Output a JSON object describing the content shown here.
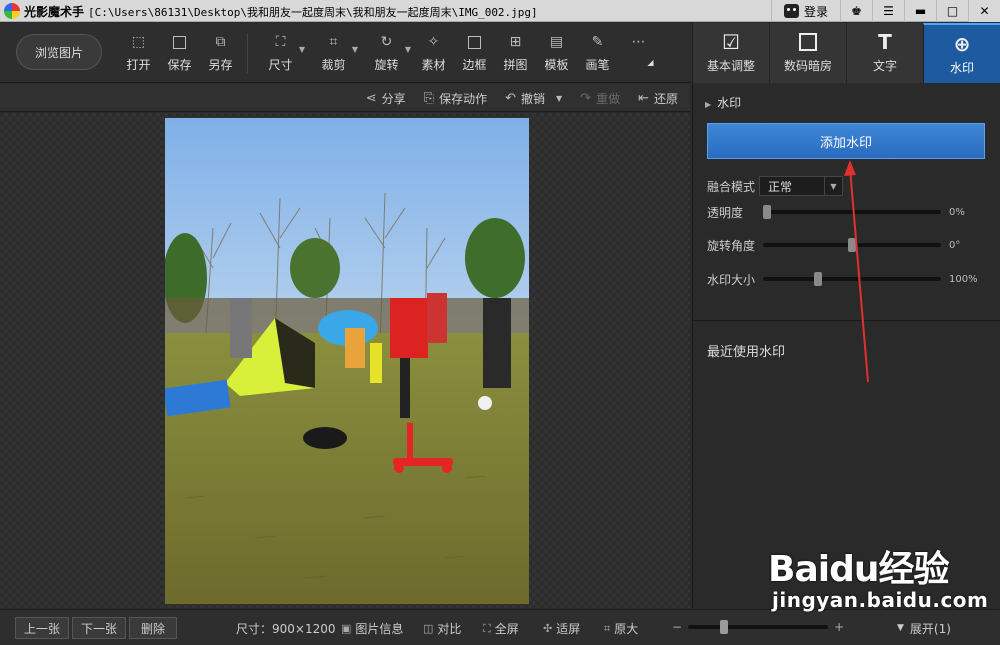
{
  "titlebar": {
    "app_name": "光影魔术手",
    "path": "[C:\\Users\\86131\\Desktop\\我和朋友一起度周末\\我和朋友一起度周末\\IMG_002.jpg]",
    "login_label": "登录"
  },
  "toolbar": {
    "browse_label": "浏览图片",
    "tools": [
      {
        "label": "打开",
        "icon": "open-icon"
      },
      {
        "label": "保存",
        "icon": "save-icon"
      },
      {
        "label": "另存",
        "icon": "save-as-icon"
      },
      {
        "label": "尺寸",
        "icon": "resize-icon"
      },
      {
        "label": "裁剪",
        "icon": "crop-icon"
      },
      {
        "label": "旋转",
        "icon": "rotate-icon"
      },
      {
        "label": "素材",
        "icon": "material-icon"
      },
      {
        "label": "边框",
        "icon": "border-icon"
      },
      {
        "label": "拼图",
        "icon": "collage-icon"
      },
      {
        "label": "模板",
        "icon": "template-icon"
      },
      {
        "label": "画笔",
        "icon": "brush-icon"
      }
    ],
    "more_icon": "more-icon"
  },
  "right_tabs": [
    {
      "label": "基本调整",
      "icon": "basic-adjust-icon"
    },
    {
      "label": "数码暗房",
      "icon": "darkroom-icon"
    },
    {
      "label": "文字",
      "icon": "text-icon"
    },
    {
      "label": "水印",
      "icon": "watermark-icon",
      "active": true
    }
  ],
  "subbar": {
    "share": "分享",
    "save_action": "保存动作",
    "undo": "撤销",
    "redo": "重做",
    "restore": "还原"
  },
  "panel": {
    "header": "水印",
    "add_button": "添加水印",
    "blend_label": "融合模式",
    "blend_value": "正常",
    "opacity_label": "透明度",
    "opacity_value": "0%",
    "opacity_level": 0,
    "rotation_label": "旋转角度",
    "rotation_value": "0°",
    "rotation_level": 0.5,
    "size_label": "水印大小",
    "size_value": "100%",
    "size_level": 0.3,
    "recent_label": "最近使用水印"
  },
  "bottombar": {
    "prev": "上一张",
    "next": "下一张",
    "delete": "删除",
    "size_info": "尺寸：900×1200",
    "image_info": "图片信息",
    "compare": "对比",
    "fullscreen": "全屏",
    "fit": "适屏",
    "original": "原大",
    "zoom_minus": "−",
    "zoom_plus": "+",
    "expand": "展开(1)"
  },
  "watermark_overlay": {
    "brand": "Baidu经验",
    "url": "jingyan.baidu.com"
  },
  "colors": {
    "accent": "#2a6cc0",
    "annotation": "#e03030"
  }
}
